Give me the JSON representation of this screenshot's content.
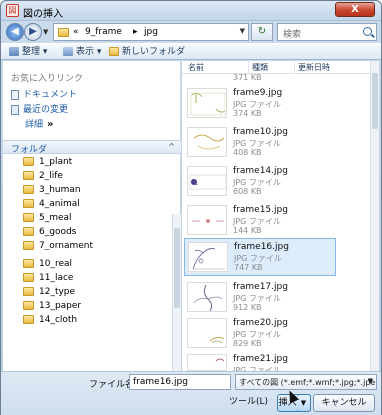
{
  "window": {
    "title": "図の挿入",
    "close_label": "X"
  },
  "address": {
    "crumbs": [
      "«",
      "9_frame",
      "▸",
      "jpg"
    ],
    "search_placeholder": "検索"
  },
  "toolbar": {
    "organize": "整理",
    "views": "表示",
    "new_folder": "新しいフォルダ"
  },
  "left": {
    "favorites_title": "お気に入りリンク",
    "favorites": [
      "ドキュメント",
      "最近の変更"
    ],
    "more": "詳細",
    "folders_title": "フォルダ",
    "tree": [
      "1_plant",
      "2_life",
      "3_human",
      "4_animal",
      "5_meal",
      "6_goods",
      "7_ornament",
      "8_line",
      "9_frame",
      "ai",
      "jpg",
      "10_real",
      "11_lace",
      "12_type",
      "13_paper",
      "14_cloth"
    ],
    "selected": "jpg"
  },
  "columns": {
    "name": "名前",
    "type": "種類",
    "date": "更新日時"
  },
  "files": [
    {
      "name": "",
      "type": "",
      "size": "371 KB"
    },
    {
      "name": "frame9.jpg",
      "type": "JPG ファイル",
      "size": "374 KB"
    },
    {
      "name": "frame10.jpg",
      "type": "JPG ファイル",
      "size": "408 KB"
    },
    {
      "name": "frame14.jpg",
      "type": "JPG ファイル",
      "size": "608 KB"
    },
    {
      "name": "frame15.jpg",
      "type": "JPG ファイル",
      "size": "144 KB"
    },
    {
      "name": "frame16.jpg",
      "type": "JPG ファイル",
      "size": "747 KB"
    },
    {
      "name": "frame17.jpg",
      "type": "JPG ファイル",
      "size": "912 KB"
    },
    {
      "name": "frame20.jpg",
      "type": "JPG ファイル",
      "size": "829 KB"
    },
    {
      "name": "frame21.jpg",
      "type": "JPG ファイル",
      "size": ""
    }
  ],
  "bottom": {
    "filename_label": "ファイル名(N):",
    "filename_value": "frame16.jpg",
    "filter": "すべての図 (*.emf;*.wmf;*.jpg;*.jpe",
    "tools": "ツール(L)",
    "insert": "挿入(S)",
    "cancel": "キャンセル"
  }
}
